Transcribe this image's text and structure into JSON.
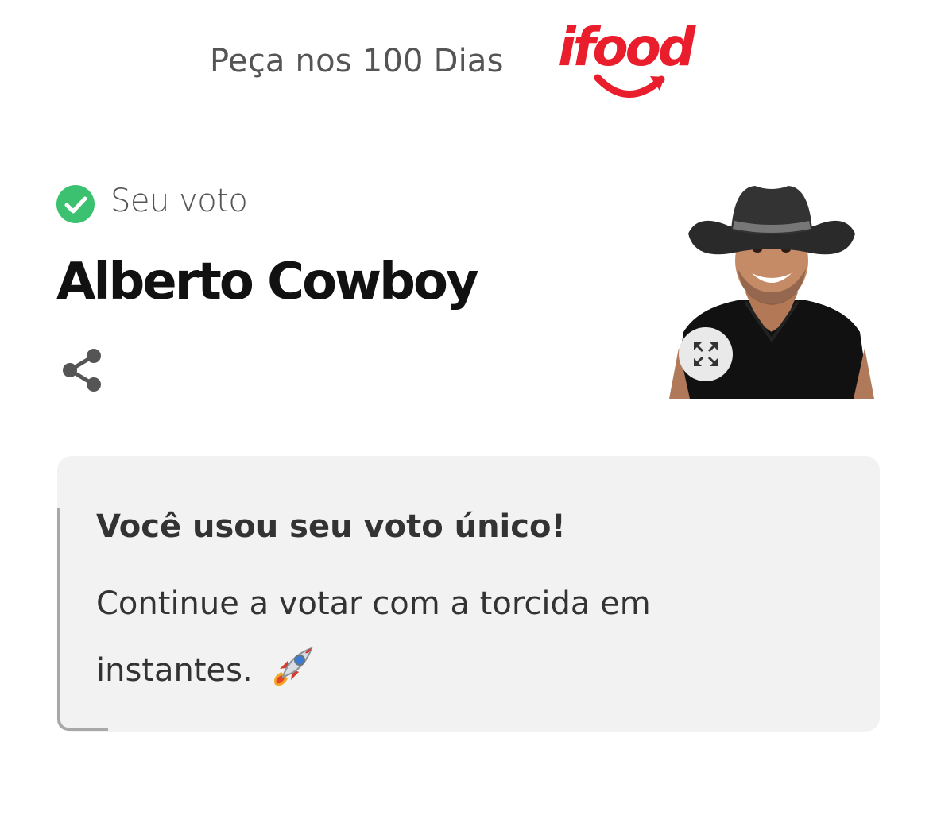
{
  "header": {
    "sponsor_text": "Peça nos 100 Dias",
    "sponsor_logo_text": "ifood",
    "brand_color": "#ea1d2c"
  },
  "vote": {
    "status_icon": "check-circle-icon",
    "status_color": "#3cc171",
    "label": "Seu voto",
    "candidate_name": "Alberto Cowboy",
    "share_icon": "share-icon",
    "expand_icon": "expand-icon"
  },
  "card": {
    "title": "Você usou seu voto único!",
    "body": "Continue a votar com a torcida em instantes.",
    "emoji_icon": "rocket-icon"
  }
}
